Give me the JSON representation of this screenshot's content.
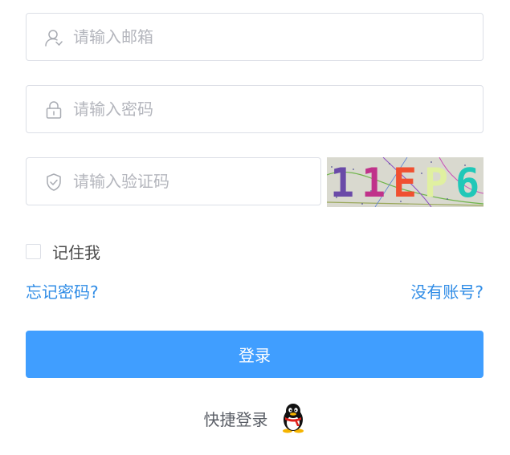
{
  "form": {
    "email_placeholder": "请输入邮箱",
    "password_placeholder": "请输入密码",
    "code_placeholder": "请输入验证码",
    "captcha_text": "11EP6",
    "remember_label": "记住我",
    "remember_checked": false,
    "forgot_link": "忘记密码?",
    "register_link": "没有账号?",
    "login_button": "登录",
    "quick_login_label": "快捷登录"
  },
  "icons": {
    "email": "user-icon",
    "password": "lock-icon",
    "code": "shield-check-icon",
    "quick_login": "qq-penguin-icon"
  },
  "colors": {
    "accent": "#409eff",
    "link": "#2f8ce6",
    "border": "#dcdfe6",
    "placeholder": "#b4b6bd"
  }
}
